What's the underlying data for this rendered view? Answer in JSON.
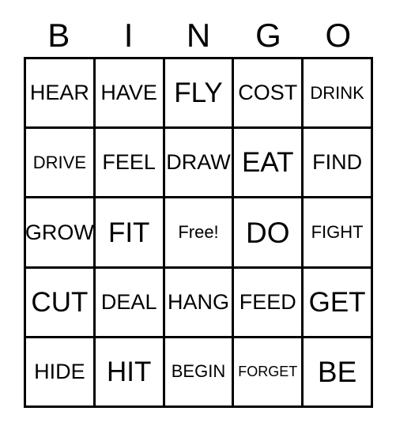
{
  "card": {
    "title": "BINGO",
    "background_color": "#ffffff",
    "line_color": "#000000",
    "text_color": "#000000"
  },
  "header": {
    "letters": [
      "B",
      "I",
      "N",
      "G",
      "O"
    ]
  },
  "grid": {
    "columns": 5,
    "rows": 5,
    "free_space": {
      "row": 2,
      "column": 2,
      "label": "Free!"
    },
    "cells": [
      [
        {
          "label": "HEAR"
        },
        {
          "label": "HAVE"
        },
        {
          "label": "FLY"
        },
        {
          "label": "COST"
        },
        {
          "label": "DRINK"
        }
      ],
      [
        {
          "label": "DRIVE"
        },
        {
          "label": "FEEL"
        },
        {
          "label": "DRAW"
        },
        {
          "label": "EAT"
        },
        {
          "label": "FIND"
        }
      ],
      [
        {
          "label": "GROW"
        },
        {
          "label": "FIT"
        },
        {
          "label": "Free!"
        },
        {
          "label": "DO"
        },
        {
          "label": "FIGHT"
        }
      ],
      [
        {
          "label": "CUT"
        },
        {
          "label": "DEAL"
        },
        {
          "label": "HANG"
        },
        {
          "label": "FEED"
        },
        {
          "label": "GET"
        }
      ],
      [
        {
          "label": "HIDE"
        },
        {
          "label": "HIT"
        },
        {
          "label": "BEGIN"
        },
        {
          "label": "FORGET"
        },
        {
          "label": "BE"
        }
      ]
    ]
  }
}
